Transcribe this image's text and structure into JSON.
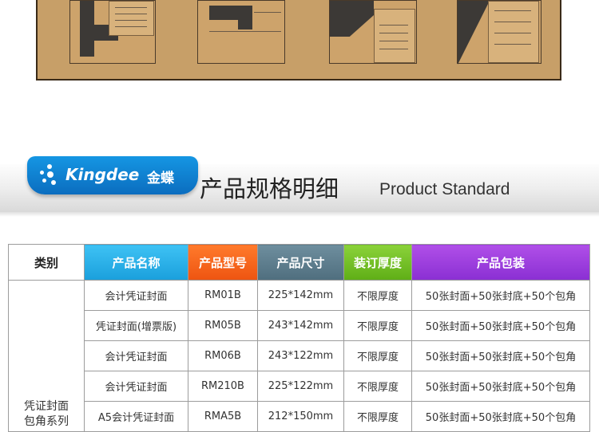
{
  "banner": {
    "logo_en": "Kingdee",
    "logo_cn": "金蝶",
    "title": "产品规格明细",
    "subtitle": "Product Standard"
  },
  "table": {
    "headers": {
      "category": "类别",
      "name": "产品名称",
      "model": "产品型号",
      "size": "产品尺寸",
      "thickness": "装订厚度",
      "package": "产品包装"
    },
    "category": "凭证封面\n包角系列",
    "rows": [
      {
        "name": "会计凭证封面",
        "model": "RM01B",
        "size": "225*142mm",
        "thickness": "不限厚度",
        "package": "50张封面+50张封底+50个包角"
      },
      {
        "name": "凭证封面(增票版)",
        "model": "RM05B",
        "size": "243*142mm",
        "thickness": "不限厚度",
        "package": "50张封面+50张封底+50个包角"
      },
      {
        "name": "会计凭证封面",
        "model": "RM06B",
        "size": "243*122mm",
        "thickness": "不限厚度",
        "package": "50张封面+50张封底+50个包角"
      },
      {
        "name": "会计凭证封面",
        "model": "RM210B",
        "size": "225*122mm",
        "thickness": "不限厚度",
        "package": "50张封面+50张封底+50个包角"
      },
      {
        "name": "A5会计凭证封面",
        "model": "RMA5B",
        "size": "212*150mm",
        "thickness": "不限厚度",
        "package": "50张封面+50张封底+50个包角"
      }
    ]
  },
  "colors": {
    "photo_background": "#c79f68",
    "logo_blue": "#0b6dbf",
    "header_name": "#1a9fdc",
    "header_model": "#ee5411",
    "header_size": "#4f6e7e",
    "header_thickness": "#5fae16",
    "header_package": "#8a2fd3"
  }
}
